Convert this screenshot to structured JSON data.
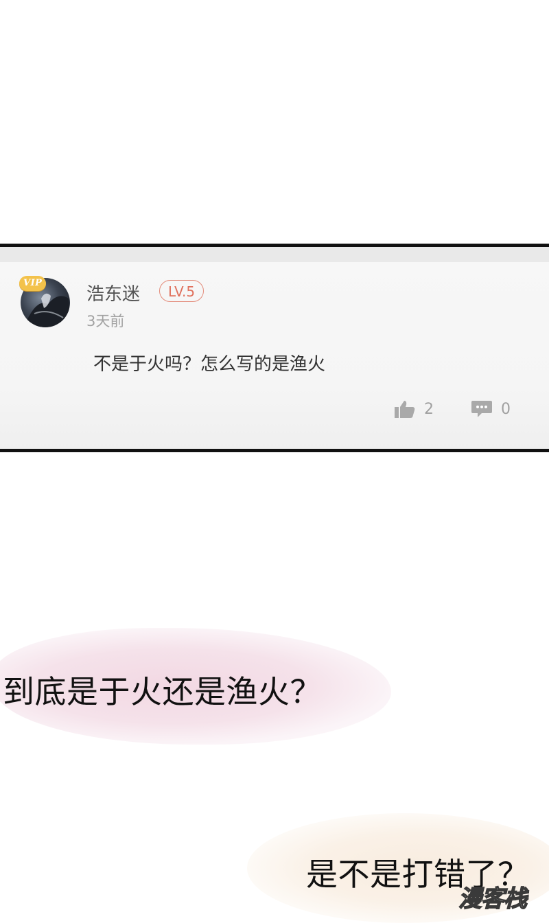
{
  "comment": {
    "vip_badge": "VIP",
    "username": "浩东迷",
    "level": "LV.5",
    "time_ago": "3天前",
    "text": "不是于火吗？怎么写的是渔火",
    "likes": "2",
    "replies": "0",
    "icons": {
      "like": "thumbs-up-icon",
      "reply": "speech-bubble-icon"
    }
  },
  "narration": [
    "到底是于火还是渔火？",
    "是不是打错了？"
  ],
  "watermark": "漫客栈",
  "colors": {
    "level_badge": "#e0705c",
    "border": "#111111"
  }
}
